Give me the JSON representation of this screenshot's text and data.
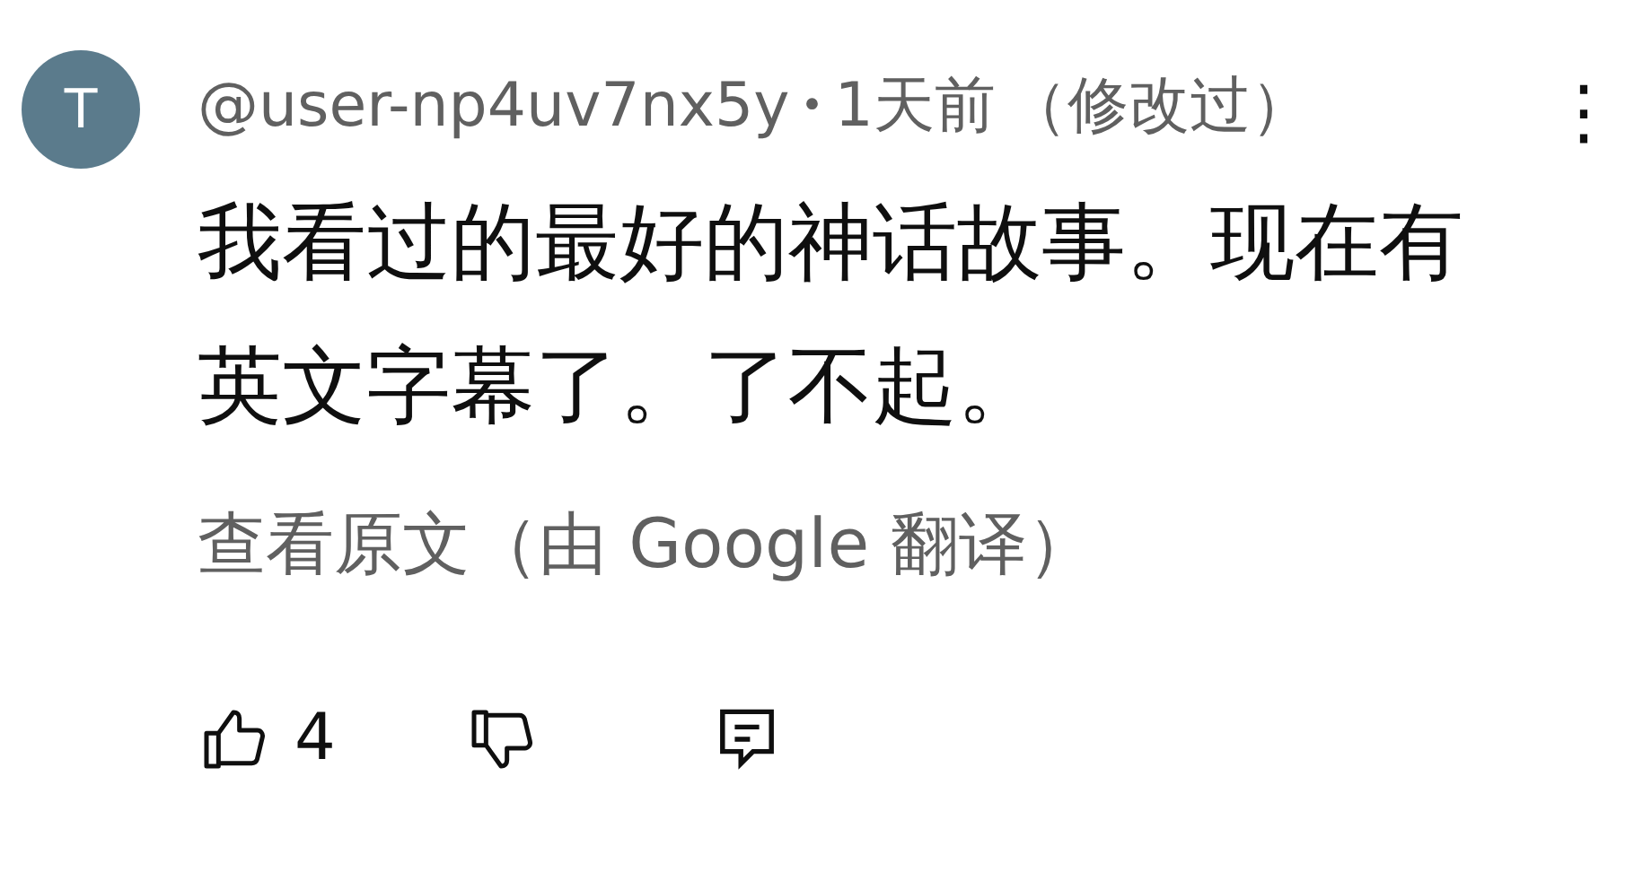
{
  "comment": {
    "avatar_letter": "T",
    "author": "@user-np4uv7nx5y",
    "separator": "•",
    "time": "1天前",
    "edited": "（修改过）",
    "menu": "⋮",
    "lines": [
      "我看过的最好的神话故事。现在有",
      "英文字幕了。了不起。"
    ],
    "translate": "查看原文（由 Google 翻译）",
    "likes": "4"
  }
}
